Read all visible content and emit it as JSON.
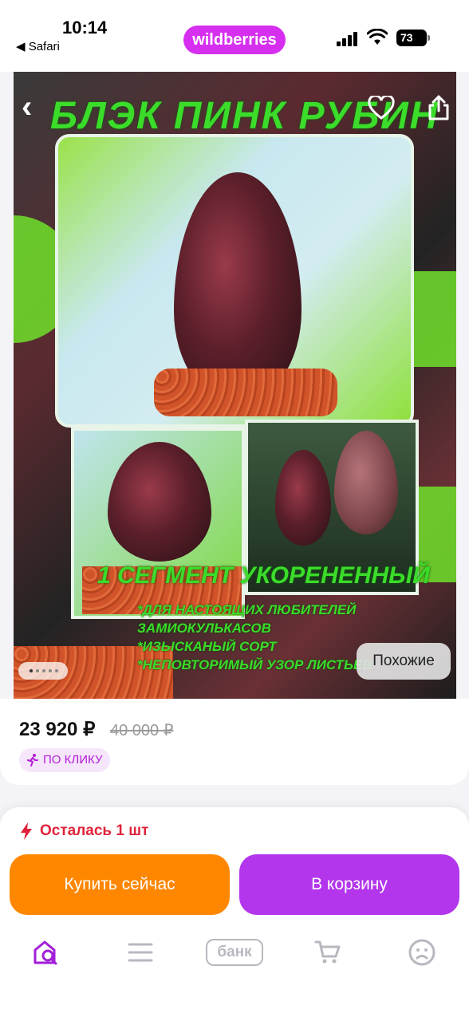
{
  "status_bar": {
    "time": "10:14",
    "back_app": "◀ Safari",
    "battery": "73"
  },
  "header": {
    "brand": "wildberries"
  },
  "product_image": {
    "title_overlay": "БЛЭК ПИНК РУБИН",
    "subtitle_overlay": "1 СЕГМЕНТ УКОРЕНЕННЫЙ",
    "bullet_lines": [
      "*ДЛЯ НАСТОЯЩИХ ЛЮБИТЕЛЕЙ",
      "ЗАМИОКУЛЬКАСОВ",
      "*ИЗЫСКАНЫЙ СОРТ",
      "*НЕПОВТОРИМЫЙ УЗОР ЛИСТЬЕВ"
    ],
    "similar_button": "Похожие"
  },
  "price": {
    "current": "23 920 ₽",
    "old": "40 000 ₽",
    "promo_label": "ПО КЛИКУ"
  },
  "stock": {
    "text": "Осталась 1 шт"
  },
  "actions": {
    "buy_now": "Купить сейчас",
    "add_to_cart": "В корзину"
  },
  "tabbar": {
    "bank_label": "банк"
  },
  "colors": {
    "brand": "#d62ff0",
    "buy_now": "#ff8700",
    "add_to_cart": "#b335ec",
    "stock_alert": "#e0233a"
  }
}
